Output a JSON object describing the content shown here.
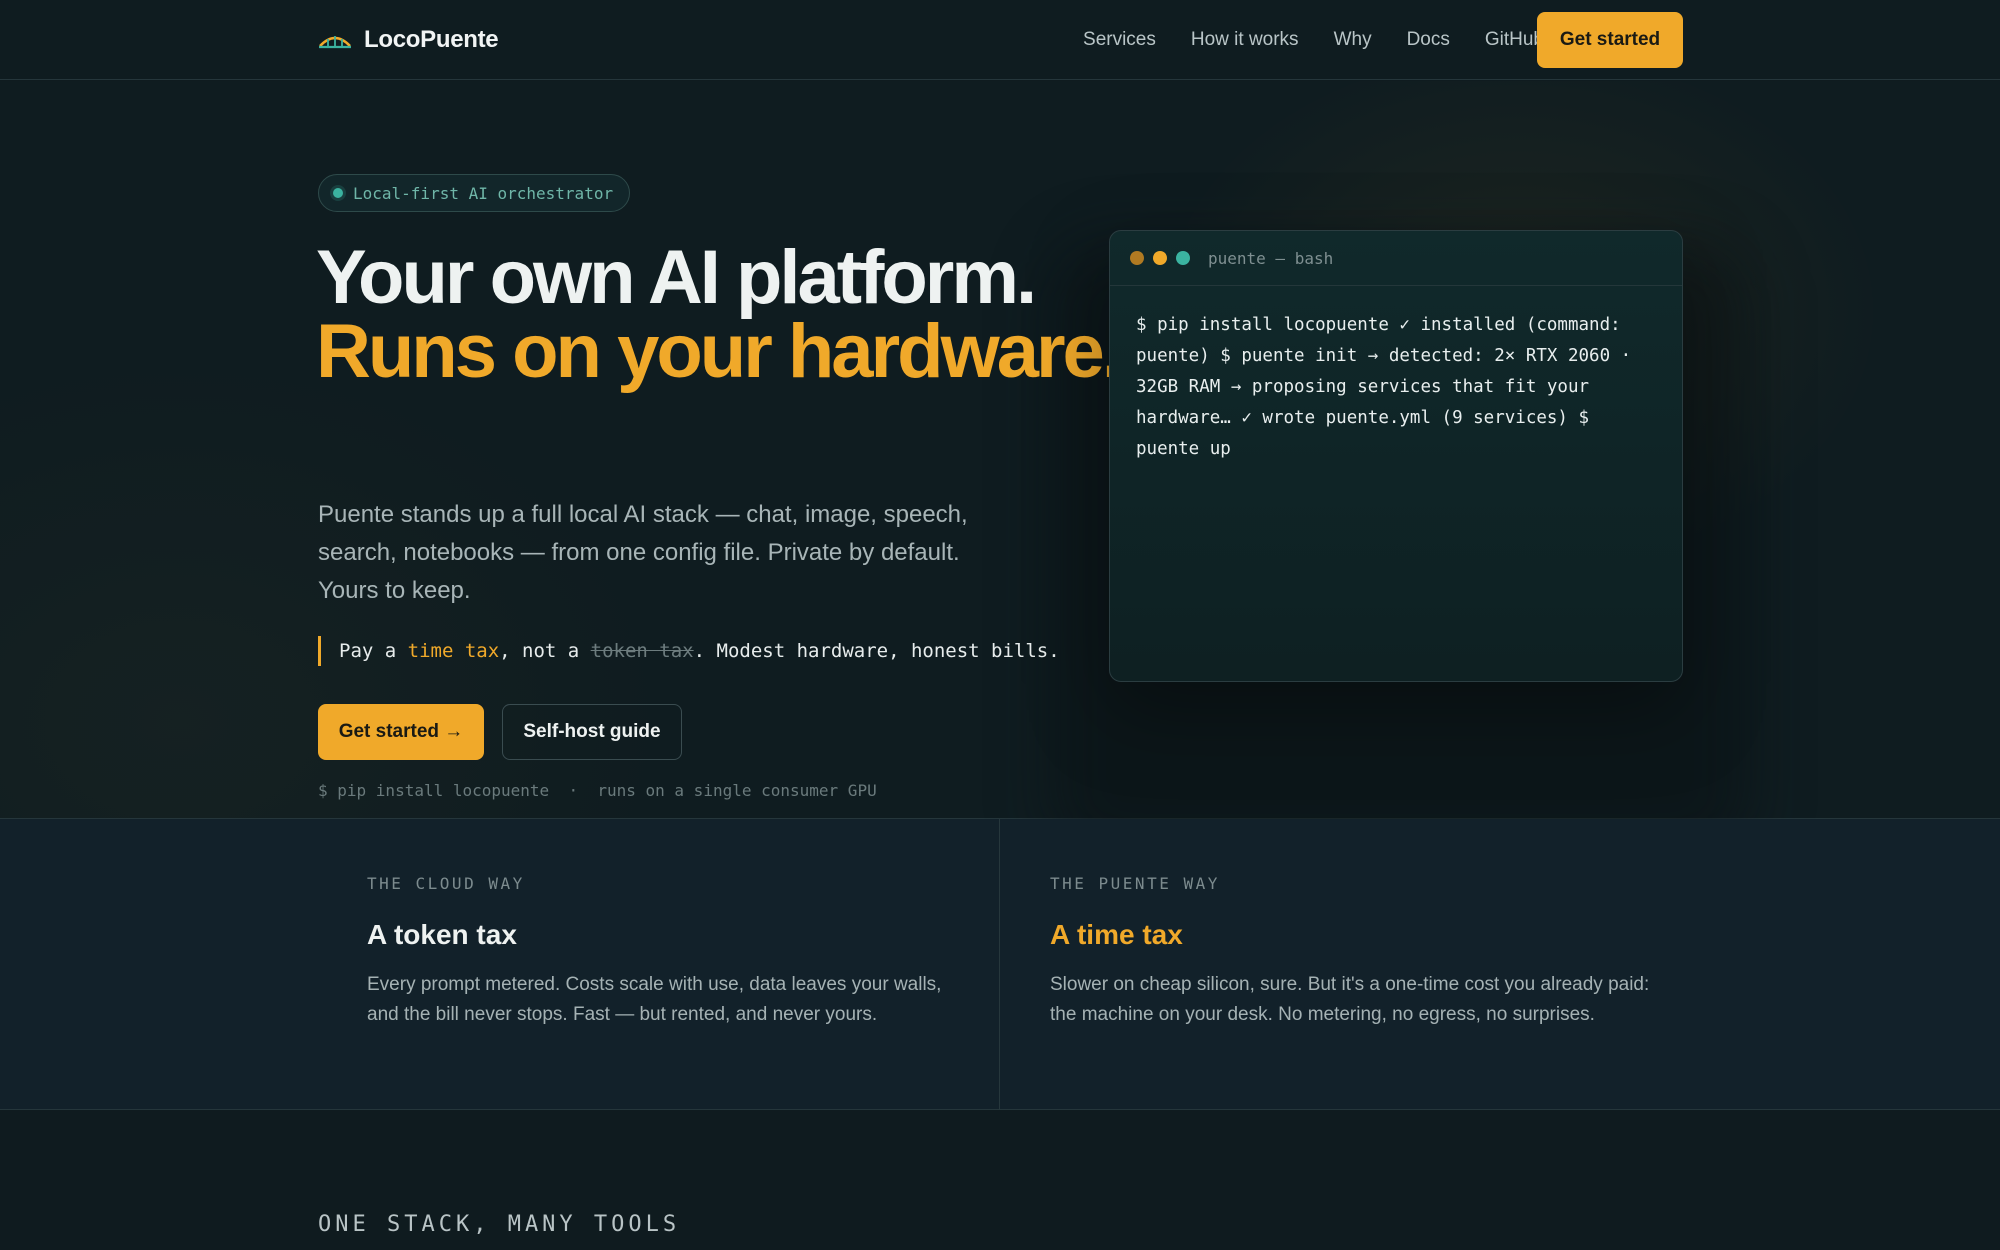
{
  "nav": {
    "brand": "LocoPuente",
    "links": [
      "Services",
      "How it works",
      "Why",
      "Docs",
      "GitHub"
    ],
    "cta": "Get started"
  },
  "hero": {
    "pill": "Local-first AI orchestrator",
    "headline_line1": "Your own AI platform.",
    "headline_line2": "Runs on your hardware.",
    "lede": "Puente stands up a full local AI stack — chat, image, speech, search, notebooks — from one config file. Private by default. Yours to keep.",
    "quote": {
      "pre": "Pay a ",
      "highlight": "time tax",
      "mid": ", not a ",
      "strike": "token tax",
      "post": ". Modest hardware, honest bills."
    },
    "primary_button": "Get started →",
    "secondary_button": "Self-host guide",
    "install_note": "$ pip install locopuente  ·  runs on a single consumer GPU"
  },
  "terminal": {
    "title": "puente — bash",
    "content": "$ pip install locopuente ✓ installed (command: puente) $ puente init → detected: 2× RTX 2060 · 32GB RAM → proposing services that fit your hardware… ✓ wrote puente.yml (9 services) $ puente up",
    "dot_colors": [
      "#b07a22",
      "#f0a92a",
      "#3bb3a0"
    ]
  },
  "compare": {
    "left": {
      "eyebrow": "THE CLOUD WAY",
      "title": "A token tax",
      "text": "Every prompt metered. Costs scale with use, data leaves your walls, and the bill never stops. Fast — but rented, and never yours."
    },
    "right": {
      "eyebrow": "THE PUENTE WAY",
      "title": "A time tax",
      "text": "Slower on cheap silicon, sure. But it's a one-time cost you already paid: the machine on your desk. No metering, no egress, no surprises."
    }
  },
  "tools_heading": "ONE STACK, MANY TOOLS",
  "colors": {
    "accent": "#f0a92a",
    "background": "#0f1c20",
    "teal": "#3bb3a0"
  }
}
